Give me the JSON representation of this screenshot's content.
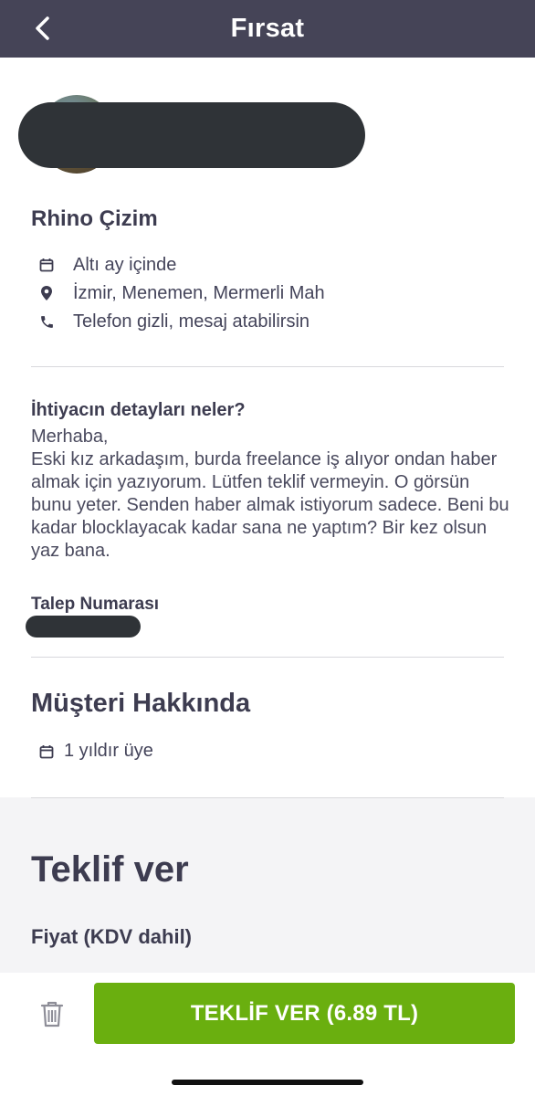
{
  "header": {
    "title": "Fırsat",
    "back_icon": "chevron-left-icon"
  },
  "job": {
    "title": "Rhino Çizim",
    "info": [
      {
        "icon": "calendar-icon",
        "text": "Altı ay içinde"
      },
      {
        "icon": "location-pin-icon",
        "text": "İzmir, Menemen, Mermerli Mah"
      },
      {
        "icon": "phone-icon",
        "text": "Telefon gizli, mesaj atabilirsin"
      }
    ],
    "details_label": "İhtiyacın detayları neler?",
    "details_text": "Merhaba,\nEski kız arkadaşım, burda freelance iş alıyor ondan haber almak için yazıyorum. Lütfen teklif vermeyin. O görsün bunu yeter.  Senden haber almak istiyorum sadece. Beni bu kadar blocklayacak kadar sana ne yaptım? Bir kez olsun yaz bana.",
    "request_number_label": "Talep Numarası"
  },
  "customer": {
    "heading": "Müşteri Hakkında",
    "member_since": "1 yıldır üye"
  },
  "offer": {
    "heading": "Teklif ver",
    "price_label": "Fiyat (KDV dahil)"
  },
  "actions": {
    "submit_label": "TEKLİF VER (6.89 TL)",
    "delete_icon": "trash-icon"
  },
  "colors": {
    "header_bg": "#454457",
    "cta_green": "#6aaf0f",
    "text_dark": "#3d3c50"
  }
}
